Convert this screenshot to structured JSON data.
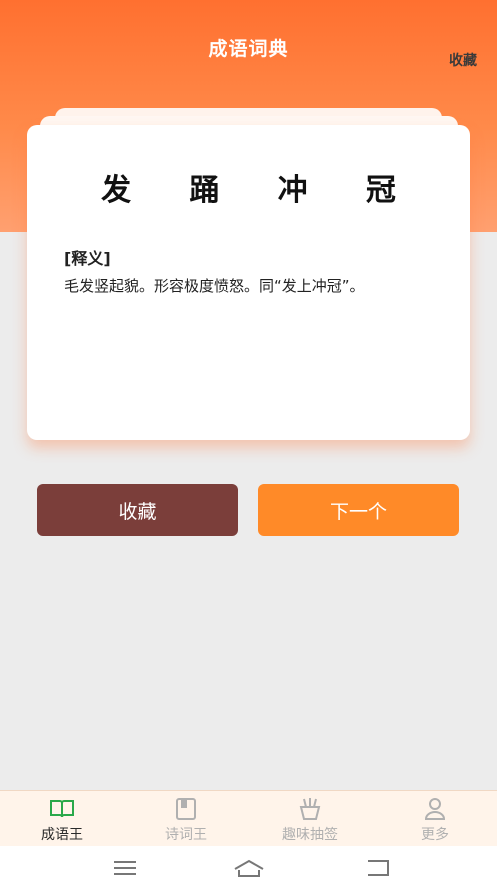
{
  "header": {
    "title": "成语词典",
    "collect_link": "收藏"
  },
  "card": {
    "idiom_chars": [
      "发",
      "踊",
      "冲",
      "冠"
    ],
    "definition_title": "[释义]",
    "definition_text": "毛发竖起貌。形容极度愤怒。同“发上冲冠”。"
  },
  "actions": {
    "collect": "收藏",
    "next": "下一个"
  },
  "tabbar": {
    "items": [
      {
        "label": "成语王",
        "icon": "book-open-icon",
        "active": true
      },
      {
        "label": "诗词王",
        "icon": "book-icon",
        "active": false
      },
      {
        "label": "趣味抽签",
        "icon": "lottery-icon",
        "active": false
      },
      {
        "label": "更多",
        "icon": "user-icon",
        "active": false
      }
    ]
  },
  "colors": {
    "accent": "#ff7a2f",
    "collect_button": "#7b3e3a",
    "next_button": "#ff8a28",
    "tab_active": "#2a2a2a",
    "tab_inactive": "#b0b0b0"
  }
}
